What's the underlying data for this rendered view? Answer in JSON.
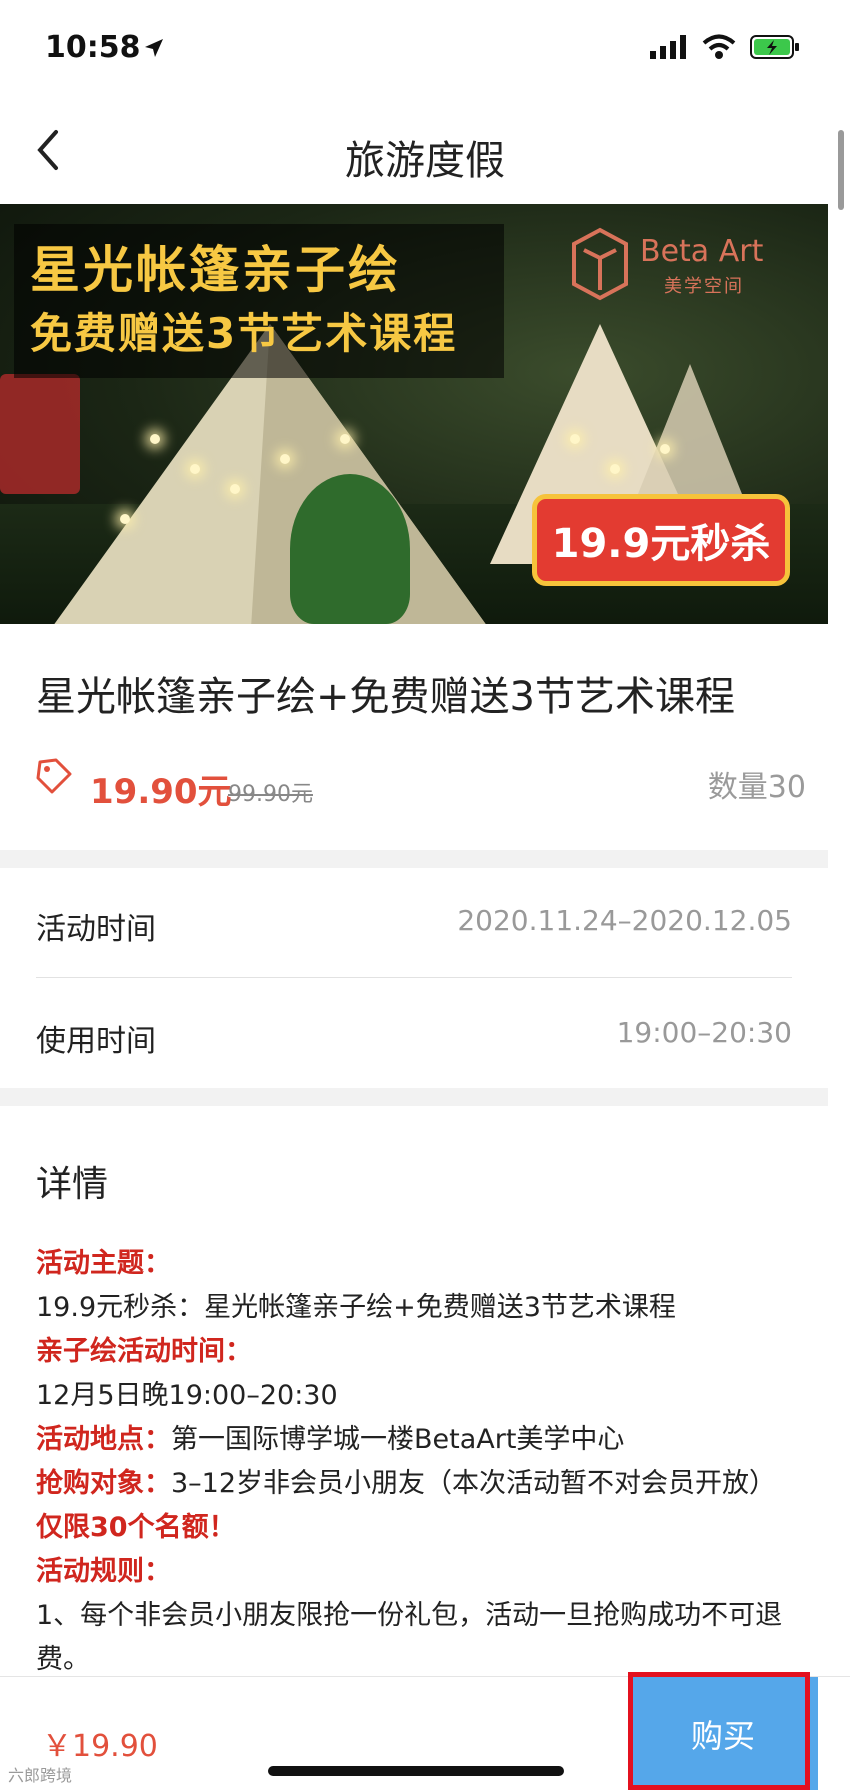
{
  "status_bar": {
    "time": "10:58"
  },
  "nav": {
    "title": "旅游度假"
  },
  "banner": {
    "headline1": "星光帐篷亲子绘",
    "headline2": "免费赠送3节艺术课程",
    "brand": "Beta Art",
    "brand_sub": "美学空间",
    "badge": "19.9元秒杀"
  },
  "product": {
    "title": "星光帐篷亲子绘+免费赠送3节艺术课程",
    "price": "19.90元",
    "original_price": "99.90元",
    "quantity": "数量30"
  },
  "info": {
    "activity_time_label": "活动时间",
    "activity_time_value": "2020.11.24–2020.12.05",
    "use_time_label": "使用时间",
    "use_time_value": "19:00–20:30"
  },
  "details": {
    "heading": "详情",
    "theme_label": "活动主题：",
    "theme_value": "19.9元秒杀：星光帐篷亲子绘+免费赠送3节艺术课程",
    "time_label": "亲子绘活动时间：",
    "time_value": "12月5日晚19:00–20:30",
    "place_label": "活动地点：",
    "place_value": "第一国际博学城一楼BetaArt美学中心",
    "target_label": "抢购对象：",
    "target_value": "3–12岁非会员小朋友（本次活动暂不对会员开放）",
    "target_limit": "仅限30个名额！",
    "rules_label": "活动规则：",
    "rules_value": "1、每个非会员小朋友限抢一份礼包，活动一旦抢购成功不可退费。"
  },
  "bottom": {
    "price": "￥19.90",
    "buy_label": "购买"
  },
  "watermark": "六郎跨境",
  "colors": {
    "accent_red": "#e2503c",
    "buy_blue": "#55a7ea",
    "banner_gold": "#f7c843"
  }
}
